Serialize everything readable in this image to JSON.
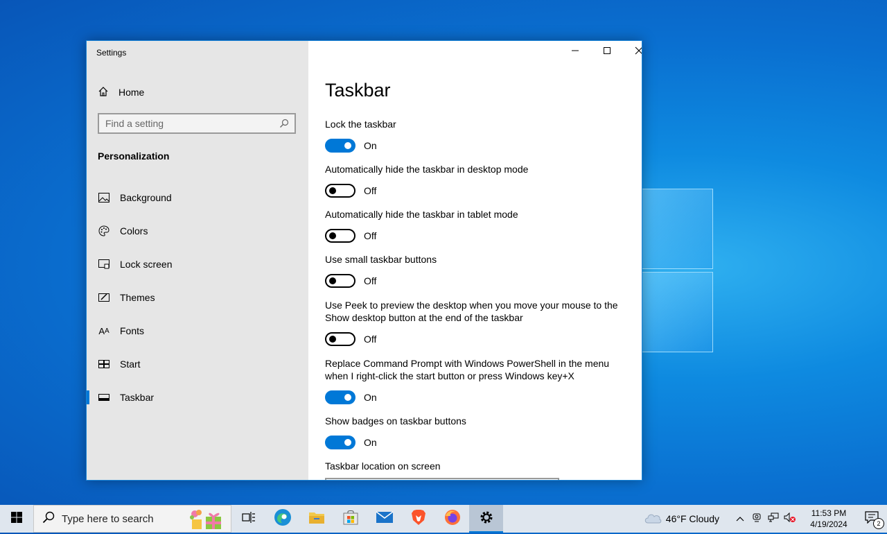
{
  "window": {
    "app_title": "Settings"
  },
  "sidebar": {
    "home_label": "Home",
    "search_placeholder": "Find a setting",
    "section_title": "Personalization",
    "items": [
      {
        "label": "Background",
        "icon": "image-icon"
      },
      {
        "label": "Colors",
        "icon": "palette-icon"
      },
      {
        "label": "Lock screen",
        "icon": "lock-screen-icon"
      },
      {
        "label": "Themes",
        "icon": "themes-icon"
      },
      {
        "label": "Fonts",
        "icon": "fonts-icon"
      },
      {
        "label": "Start",
        "icon": "start-icon"
      },
      {
        "label": "Taskbar",
        "icon": "taskbar-icon",
        "active": true
      }
    ]
  },
  "page": {
    "title": "Taskbar",
    "settings": [
      {
        "label": "Lock the taskbar",
        "state": "On"
      },
      {
        "label": "Automatically hide the taskbar in desktop mode",
        "state": "Off"
      },
      {
        "label": "Automatically hide the taskbar in tablet mode",
        "state": "Off"
      },
      {
        "label": "Use small taskbar buttons",
        "state": "Off"
      },
      {
        "label": "Use Peek to preview the desktop when you move your mouse to the Show desktop button at the end of the taskbar",
        "state": "Off"
      },
      {
        "label": "Replace Command Prompt with Windows PowerShell in the menu when I right-click the start button or press Windows key+X",
        "state": "On"
      },
      {
        "label": "Show badges on taskbar buttons",
        "state": "On"
      }
    ],
    "location_label": "Taskbar location on screen"
  },
  "taskbar": {
    "search_text": "Type here to search",
    "apps": [
      "task-view-icon",
      "edge-icon",
      "file-explorer-icon",
      "store-icon",
      "mail-icon",
      "brave-icon",
      "firefox-icon",
      "settings-icon"
    ],
    "weather": "46°F  Cloudy",
    "time": "11:53 PM",
    "date": "4/19/2024",
    "notification_count": "2"
  },
  "colors": {
    "accent": "#0078d7",
    "sidebar_bg": "#e6e6e6",
    "taskbar_bg": "#dfe6ee"
  }
}
